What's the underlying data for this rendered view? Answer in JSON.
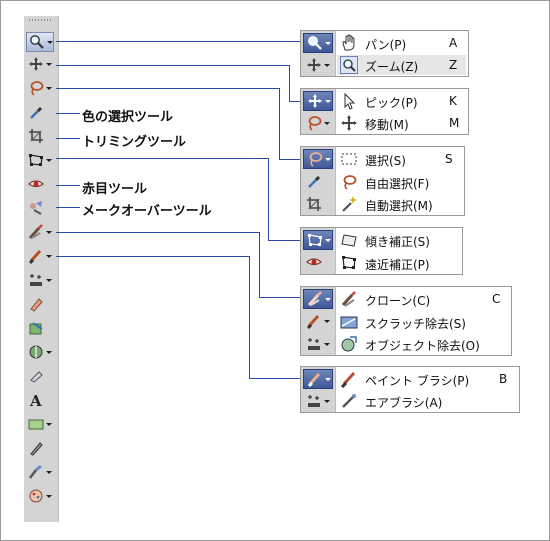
{
  "toolbar": {
    "tools": [
      {
        "icon": "magnifier-icon",
        "has_menu": true,
        "active": true
      },
      {
        "icon": "move-arrows-icon",
        "has_menu": true
      },
      {
        "icon": "lasso-icon",
        "has_menu": true
      },
      {
        "icon": "eyedropper-icon",
        "has_menu": false
      },
      {
        "icon": "crop-icon",
        "has_menu": false
      },
      {
        "icon": "perspective-box-icon",
        "has_menu": true
      },
      {
        "icon": "red-eye-icon",
        "has_menu": false
      },
      {
        "icon": "makeover-icon",
        "has_menu": false
      },
      {
        "icon": "clone-brush-icon",
        "has_menu": true
      },
      {
        "icon": "paint-brush-icon",
        "has_menu": true
      },
      {
        "icon": "sparkle-stamp-icon",
        "has_menu": true
      },
      {
        "icon": "eraser-icon",
        "has_menu": false
      },
      {
        "icon": "fill-icon",
        "has_menu": false
      },
      {
        "icon": "gradient-icon",
        "has_menu": true
      },
      {
        "icon": "smudge-icon",
        "has_menu": false
      },
      {
        "icon": "text-icon",
        "has_menu": false
      },
      {
        "icon": "shape-icon",
        "has_menu": true
      },
      {
        "icon": "pen-icon",
        "has_menu": false
      },
      {
        "icon": "retouch-icon",
        "has_menu": true
      },
      {
        "icon": "texture-icon",
        "has_menu": true
      }
    ]
  },
  "callouts": {
    "color_select": "色の選択ツール",
    "trimming": "トリミングツール",
    "red_eye": "赤目ツール",
    "makeover": "メークオーバーツール"
  },
  "panels": [
    {
      "id": "view",
      "rows": [
        {
          "icon": "hand-icon",
          "label": "パン(P)",
          "key": "A"
        },
        {
          "icon": "zoom-icon",
          "label": "ズーム(Z)",
          "key": "Z",
          "selected": true
        }
      ]
    },
    {
      "id": "pick",
      "rows": [
        {
          "icon": "arrow-pointer-icon",
          "label": "ピック(P)",
          "key": "K"
        },
        {
          "icon": "move-arrows-icon",
          "label": "移動(M)",
          "key": "M"
        }
      ]
    },
    {
      "id": "select",
      "rows": [
        {
          "icon": "marquee-icon",
          "label": "選択(S)",
          "key": "S"
        },
        {
          "icon": "lasso-icon",
          "label": "自由選択(F)",
          "key": ""
        },
        {
          "icon": "magic-wand-icon",
          "label": "自動選択(M)",
          "key": ""
        }
      ]
    },
    {
      "id": "perspective",
      "rows": [
        {
          "icon": "skew-icon",
          "label": "傾き補正(S)",
          "key": ""
        },
        {
          "icon": "perspective-box-icon",
          "label": "遠近補正(P)",
          "key": ""
        }
      ]
    },
    {
      "id": "clone",
      "rows": [
        {
          "icon": "clone-brush-icon",
          "label": "クローン(C)",
          "key": "C"
        },
        {
          "icon": "scratch-remover-icon",
          "label": "スクラッチ除去(S)",
          "key": ""
        },
        {
          "icon": "object-remover-icon",
          "label": "オブジェクト除去(O)",
          "key": ""
        }
      ]
    },
    {
      "id": "brush",
      "rows": [
        {
          "icon": "paint-brush-icon",
          "label": "ペイント ブラシ(P)",
          "key": "B"
        },
        {
          "icon": "airbrush-icon",
          "label": "エアブラシ(A)",
          "key": ""
        }
      ]
    }
  ]
}
